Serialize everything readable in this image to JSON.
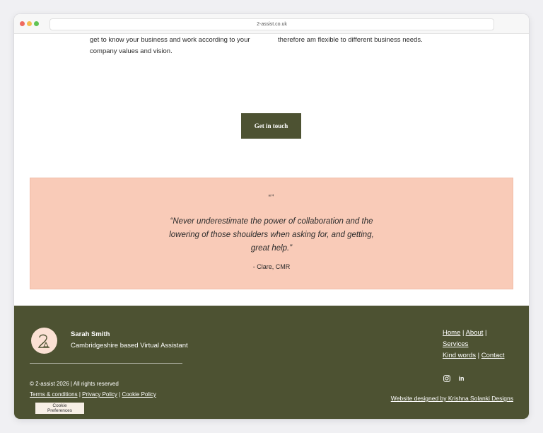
{
  "browser": {
    "url": "2-assist.co.uk"
  },
  "intro": {
    "left_text": "get to know your business and work according to your company values and vision.",
    "right_text": "therefore am flexible to different business needs."
  },
  "cta": {
    "label": "Get in touch"
  },
  "testimonial": {
    "quote_mark": "“”",
    "quote": "“Never underestimate the power of collaboration and the lowering of those shoulders when asking for, and getting, great help.”",
    "author": "- Clare, CMR"
  },
  "footer": {
    "name": "Sarah Smith",
    "tagline": "Cambridgeshire based Virtual Assistant",
    "copyright": "© 2-assist 2026 | All rights reserved",
    "legal": {
      "terms": "Terms & conditions",
      "privacy": "Privacy Policy",
      "cookie": "Cookie Policy",
      "sep": " | "
    },
    "nav": {
      "home": "Home",
      "about": "About",
      "services": "Services",
      "kind_words": "Kind words",
      "contact": "Contact",
      "sep": " | "
    },
    "credit": "Website designed by Krishna Solanki Designs",
    "social": {
      "linkedin": "in"
    }
  },
  "cookie_preferences": {
    "label": "Cookie Preferences"
  },
  "colors": {
    "olive": "#4d5232",
    "peach": "#f9cbb8",
    "cream": "#fbe1d4"
  },
  "icons": [
    "instagram-icon",
    "linkedin-icon",
    "logo-2-icon"
  ]
}
